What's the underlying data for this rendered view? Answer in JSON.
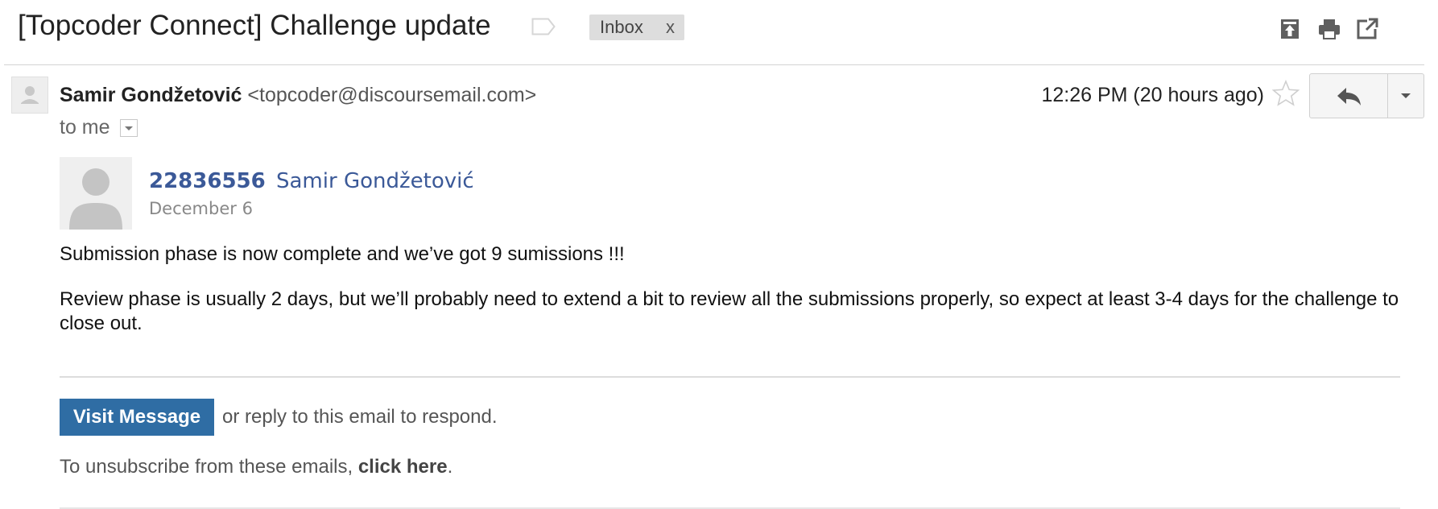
{
  "email": {
    "subject": "[Topcoder Connect] Challenge update",
    "label": {
      "name": "Inbox",
      "remove": "x"
    },
    "header_icons": [
      "collapse-icon",
      "print-icon",
      "new-window-icon"
    ],
    "sender": {
      "name": "Samir Gondžetović",
      "email": "<topcoder@discoursemail.com>",
      "recipient": "to me"
    },
    "timestamp": "12:26 PM (20 hours ago)",
    "post": {
      "username": "22836556",
      "full_name": "Samir Gondžetović",
      "date": "December 6",
      "paragraphs": [
        "Submission phase is now complete and we’ve got 9 sumissions !!!",
        "Review phase is usually 2 days, but we’ll probably need to extend a bit to review all the submissions properly, so expect at least 3-4 days for the challenge to close out."
      ]
    },
    "footer": {
      "visit_button": "Visit Message",
      "visit_after": "or reply to this email to respond.",
      "unsubscribe_before": "To unsubscribe from these emails, ",
      "unsubscribe_link": "click here",
      "unsubscribe_after": "."
    }
  },
  "colors": {
    "link_blue": "#3b5998",
    "button_blue": "#2f6da4",
    "label_bg": "#dddddd"
  }
}
